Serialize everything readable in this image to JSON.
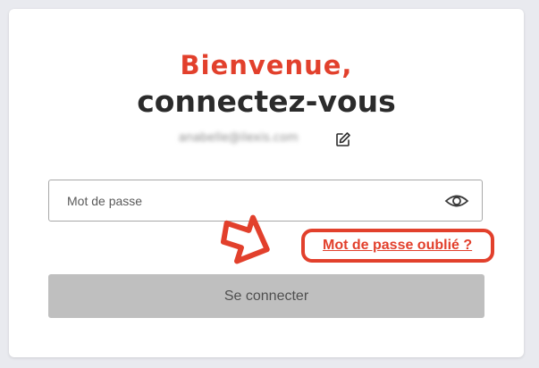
{
  "login": {
    "greeting": "Bienvenue,",
    "heading": "connectez-vous",
    "email": "anabelle@ilexis.com",
    "password_placeholder": "Mot de passe",
    "forgot_password_label": "Mot de passe oublié ?",
    "submit_label": "Se connecter"
  },
  "icons": {
    "edit": "pencil-square-icon",
    "toggle_password": "eye-icon",
    "annotation": "arrow-right-icon"
  },
  "colors": {
    "accent": "#e2402c",
    "text_dark": "#2b2b2b",
    "button_disabled": "#bfbfbf",
    "background": "#e9eaef"
  }
}
